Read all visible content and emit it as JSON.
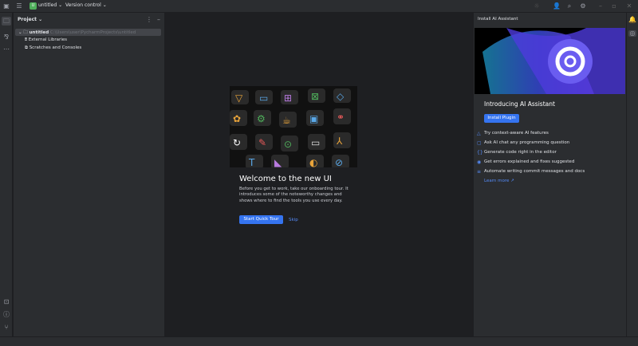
{
  "titlebar": {
    "project_badge": "U",
    "project_name": "untitled",
    "vcs": "Version control"
  },
  "project_panel": {
    "title": "Project",
    "root": "untitled",
    "root_path": "C:\\Users\\user\\PycharmProjects\\untitled",
    "items": [
      "External Libraries",
      "Scratches and Consoles"
    ]
  },
  "welcome": {
    "title": "Welcome to the new UI",
    "body": "Before you get to work, take our onboarding tour. It introduces some of the noteworthy changes and shows where to find the tools you use every day.",
    "start": "Start Quick Tour",
    "skip": "Skip"
  },
  "ai": {
    "header": "Install AI Assistant",
    "title": "Introducing AI Assistant",
    "install": "Install Plugin",
    "features": [
      "Try context-aware AI features",
      "Ask AI chat any programming question",
      "Generate code right in the editor",
      "Get errors explained and fixes suggested",
      "Automate writing commit messages and docs"
    ],
    "learn_more": "Learn more ↗"
  },
  "colors": {
    "accent": "#3574f0",
    "badge": "#4fb05b"
  }
}
